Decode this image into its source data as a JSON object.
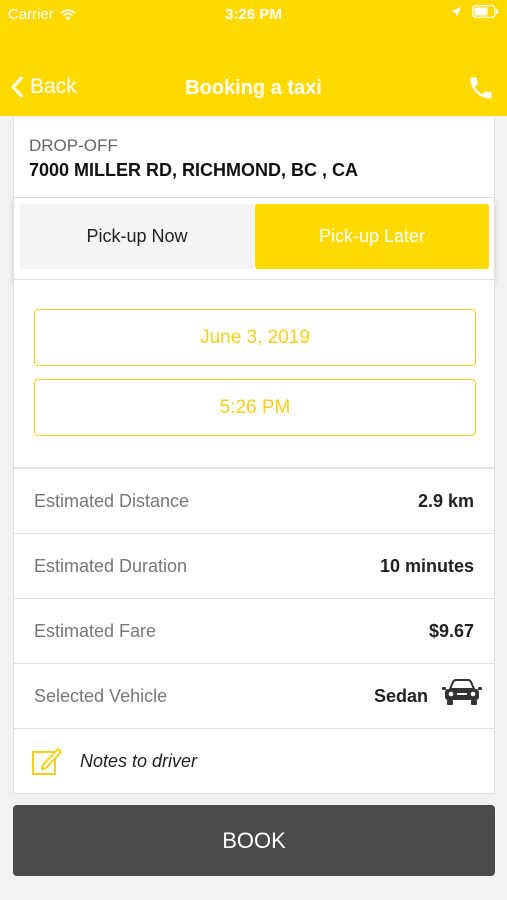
{
  "status": {
    "carrier": "Carrier",
    "time": "3:26 PM"
  },
  "nav": {
    "back": "Back",
    "title": "Booking a taxi"
  },
  "dropoff": {
    "label": "DROP-OFF",
    "address": "7000 MILLER RD, RICHMOND, BC , CA"
  },
  "pickup": {
    "now_label": "Pick-up Now",
    "later_label": "Pick-up Later",
    "selected": "later",
    "date": "June 3, 2019",
    "time": "5:26 PM"
  },
  "details": {
    "distance": {
      "label": "Estimated Distance",
      "value": "2.9 km"
    },
    "duration": {
      "label": "Estimated Duration",
      "value": "10 minutes"
    },
    "fare": {
      "label": "Estimated Fare",
      "value": "$9.67"
    },
    "vehicle": {
      "label": "Selected Vehicle",
      "value": "Sedan",
      "icon": "car-icon"
    },
    "notes": {
      "label": "Notes to driver",
      "icon": "edit-note-icon"
    }
  },
  "book_label": "BOOK",
  "colors": {
    "accent": "#ffd900",
    "date_border": "#f2cf1a",
    "book_button": "#4a4a4a"
  }
}
